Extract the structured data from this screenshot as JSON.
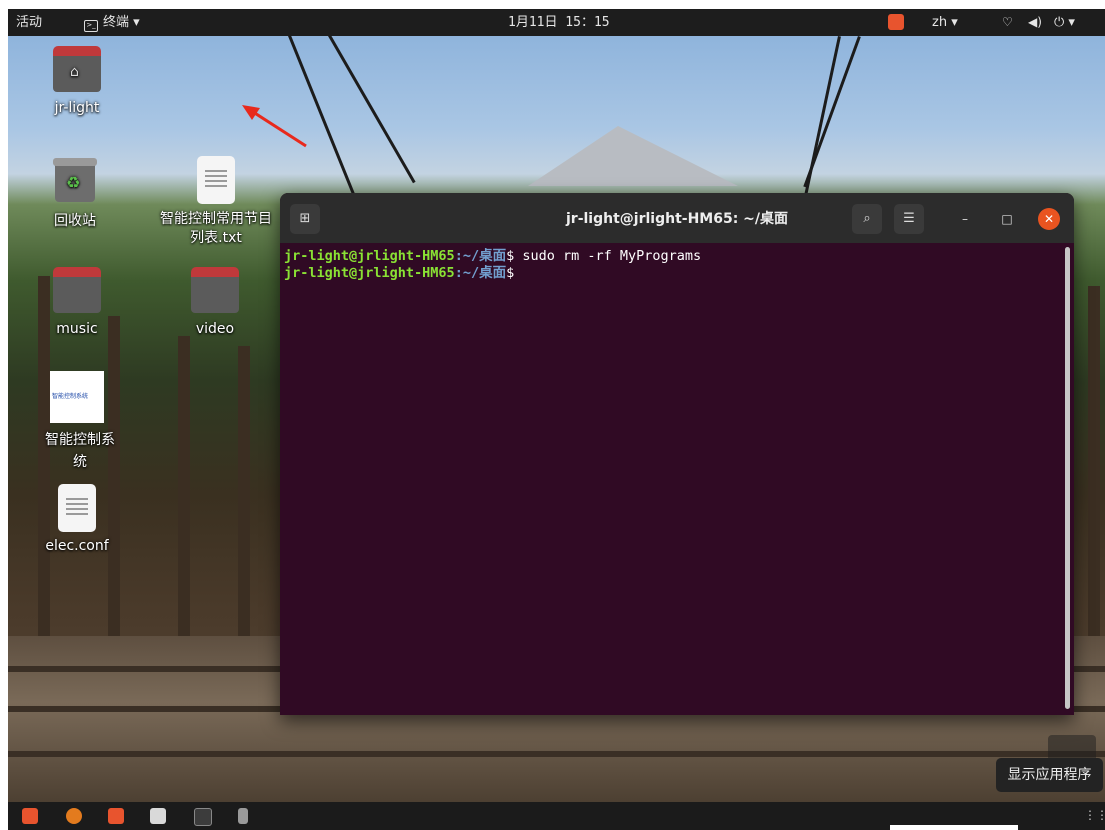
{
  "topbar": {
    "activities": "活动",
    "app_menu": "终端 ▾",
    "clock": "1月11日 15：15",
    "lang": "zh ▾",
    "network_icon": "♡",
    "volume_icon": "◀)",
    "power_icon": "⏻ ▾"
  },
  "desktop_icons": {
    "home_label": "jr-light",
    "trash_label": "回收站",
    "txt_label": "智能控制常用节目列表.txt",
    "music_label": "music",
    "video_label": "video",
    "app_label": "智能控制系统",
    "app_logo_text": "智能控制系统",
    "conf_label": "elec.conf"
  },
  "terminal": {
    "title": "jr-light@jrlight-HM65: ~/桌面",
    "line1_user": "jr-light@jrlight-HM65",
    "line1_path": ":~/桌面",
    "line1_cmd": "$ sudo rm -rf MyPrograms",
    "line2_user": "jr-light@jrlight-HM65",
    "line2_path": ":~/桌面",
    "line2_cmd": "$"
  },
  "tooltip": "显示应用程序",
  "colors": {
    "terminal_bg": "#300a24",
    "prompt_user": "#8ae234",
    "prompt_path": "#729fcf",
    "accent": "#e95420"
  }
}
